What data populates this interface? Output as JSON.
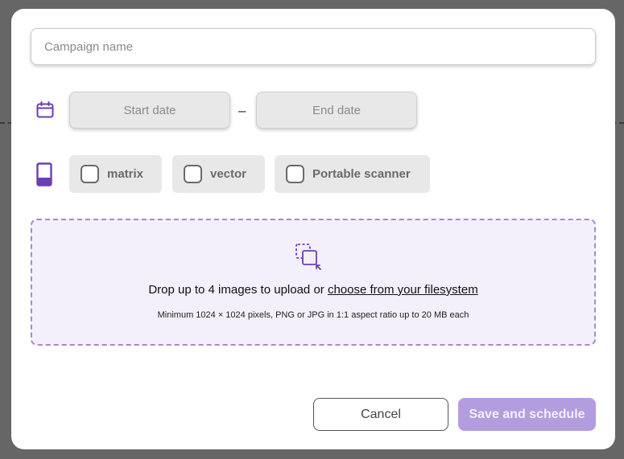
{
  "campaign": {
    "name_placeholder": "Campaign name",
    "name_value": ""
  },
  "dates": {
    "icon": "calendar-icon",
    "start_placeholder": "Start date",
    "separator": "–",
    "end_placeholder": "End date"
  },
  "devices": {
    "icon": "mobile-device-icon",
    "options": [
      {
        "label": "matrix",
        "checked": false
      },
      {
        "label": "vector",
        "checked": false
      },
      {
        "label": "Portable scanner",
        "checked": false
      }
    ]
  },
  "upload": {
    "icon": "drag-drop-icon",
    "text_before": "Drop up to 4 images to upload or ",
    "link_text": "choose from your filesystem",
    "requirements": "Minimum 1024 × 1024 pixels, PNG or JPG in 1:1 aspect ratio up to 20 MB each"
  },
  "actions": {
    "cancel_label": "Cancel",
    "save_label": "Save and schedule"
  },
  "colors": {
    "accent": "#6a3fb5",
    "save_button": "#b39ddf",
    "dropzone_bg": "#f4f0fb",
    "dropzone_border": "#a58ac8"
  }
}
